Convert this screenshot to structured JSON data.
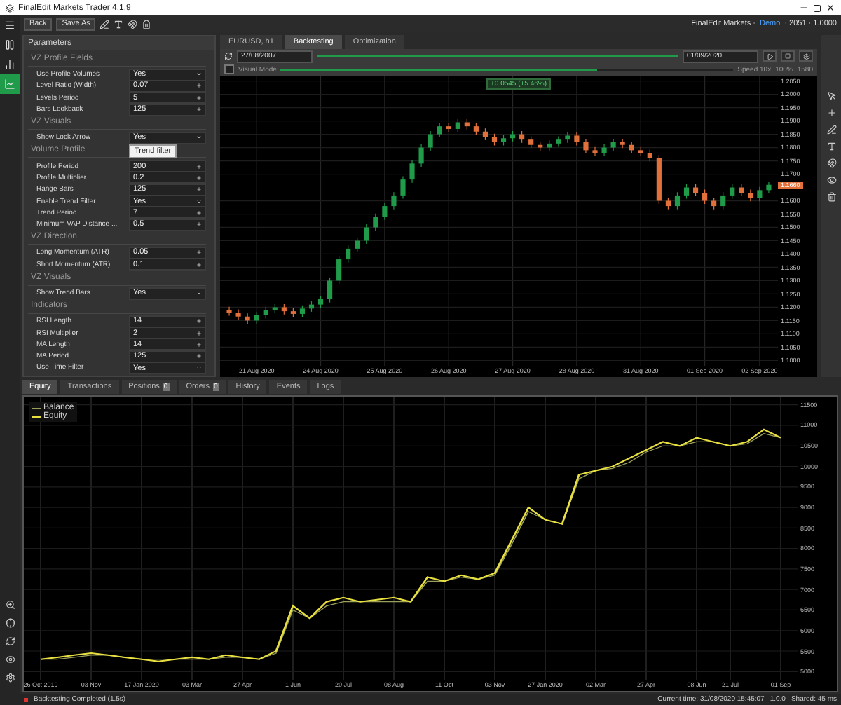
{
  "window": {
    "title": "FinalEdit Markets Trader 4.1.9"
  },
  "rail": {
    "items": [
      {
        "kind": "menu",
        "selected": false
      },
      {
        "kind": "pause",
        "selected": false
      },
      {
        "kind": "trade",
        "selected": false
      },
      {
        "kind": "chart",
        "selected": true
      }
    ]
  },
  "toolbar": {
    "buttons": [
      "Back",
      "Save As"
    ],
    "account": "FinalEdit Markets ·",
    "account_mode": "Demo",
    "account_info": "· 2051 · 1.0000"
  },
  "parameters": {
    "title": "Parameters",
    "sections": [
      {
        "title": "VZ Profile Fields",
        "rows": [
          {
            "label": "Use Profile Volumes",
            "value": "Yes",
            "kind": "select"
          },
          {
            "label": "Level Ratio (Width)",
            "value": "0.07",
            "kind": "number"
          },
          {
            "label": "Levels Period",
            "value": "5",
            "kind": "number"
          },
          {
            "label": "Bars Lookback",
            "value": "125",
            "kind": "number"
          }
        ]
      },
      {
        "title": "VZ Visuals",
        "rows": [
          {
            "label": "Show Lock Arrow",
            "value": "Yes",
            "kind": "select"
          }
        ]
      },
      {
        "title": "Volume Profile",
        "rows": [
          {
            "label": "Profile Period",
            "value": "200",
            "kind": "number"
          },
          {
            "label": "Profile Multiplier",
            "value": "0.2",
            "kind": "number"
          },
          {
            "label": "Range Bars",
            "value": "125",
            "kind": "number"
          },
          {
            "label": "Enable Trend Filter",
            "value": "Yes",
            "kind": "select"
          },
          {
            "label": "Trend Period",
            "value": "7",
            "kind": "number"
          },
          {
            "label": "Minimum VAP Distance ...",
            "value": "0.5",
            "kind": "number"
          }
        ]
      },
      {
        "title": "VZ Direction",
        "rows": [
          {
            "label": "Long Momentum (ATR)",
            "value": "0.05",
            "kind": "number"
          },
          {
            "label": "Short Momentum (ATR)",
            "value": "0.1",
            "kind": "number"
          }
        ]
      },
      {
        "title": "VZ Visuals",
        "rows": [
          {
            "label": "Show Trend Bars",
            "value": "Yes",
            "kind": "select"
          }
        ]
      },
      {
        "title": "Indicators",
        "rows": [
          {
            "label": "RSI Length",
            "value": "14",
            "kind": "number"
          },
          {
            "label": "RSI Multiplier",
            "value": "2",
            "kind": "number"
          },
          {
            "label": "MA Length",
            "value": "14",
            "kind": "number"
          },
          {
            "label": "MA Period",
            "value": "125",
            "kind": "number"
          },
          {
            "label": "Use Time Filter",
            "value": "Yes",
            "kind": "select"
          }
        ]
      }
    ],
    "tooltip": "Trend filter"
  },
  "chart_tabs": [
    {
      "label": "EURUSD, h1",
      "selected": false
    },
    {
      "label": "Backtesting",
      "selected": true
    },
    {
      "label": "Optimization",
      "selected": false
    }
  ],
  "backtest": {
    "start_date": "27/08/2007",
    "end_date": "01/09/2020",
    "progress_bar": {
      "level": 1.0
    },
    "visual_mode": {
      "label": "Visual Mode",
      "checked": false
    },
    "speed_label": "Speed 10x",
    "speed_slider": {
      "level": 0.7
    },
    "speed_value": "100%",
    "readout": "1580"
  },
  "chart": {
    "crosshair_label": "+0.0545 (+5.46%)",
    "chart_data": {
      "type": "candlestick",
      "categories": [
        null,
        null,
        null,
        "21 Aug 2020",
        null,
        null,
        null,
        null,
        null,
        null,
        "24 Aug 2020",
        null,
        null,
        null,
        null,
        null,
        null,
        "25 Aug 2020",
        null,
        null,
        null,
        null,
        null,
        null,
        "26 Aug 2020",
        null,
        null,
        null,
        null,
        null,
        null,
        "27 Aug 2020",
        null,
        null,
        null,
        null,
        null,
        null,
        "28 Aug 2020",
        null,
        null,
        null,
        null,
        null,
        null,
        "31 Aug 2020",
        null,
        null,
        null,
        null,
        null,
        null,
        "01 Sep 2020",
        null,
        null,
        null,
        null,
        null,
        "02 Sep 2020",
        null
      ],
      "grid": true,
      "ylim": [
        1.098,
        1.207
      ],
      "ohlc": [
        [
          1.119,
          1.1202,
          1.1168,
          1.118
        ],
        [
          1.118,
          1.1192,
          1.1153,
          1.1165
        ],
        [
          1.1165,
          1.1177,
          1.1138,
          1.115
        ],
        [
          1.115,
          1.1182,
          1.1138,
          1.117
        ],
        [
          1.117,
          1.1202,
          1.1158,
          1.119
        ],
        [
          1.119,
          1.1212,
          1.1178,
          1.12
        ],
        [
          1.12,
          1.1212,
          1.1173,
          1.1185
        ],
        [
          1.1185,
          1.1197,
          1.1163,
          1.1175
        ],
        [
          1.1175,
          1.1207,
          1.1163,
          1.1195
        ],
        [
          1.1195,
          1.1222,
          1.1183,
          1.121
        ],
        [
          1.121,
          1.1242,
          1.1198,
          1.123
        ],
        [
          1.123,
          1.1312,
          1.1218,
          1.13
        ],
        [
          1.13,
          1.1392,
          1.1288,
          1.138
        ],
        [
          1.138,
          1.1432,
          1.1368,
          1.142
        ],
        [
          1.142,
          1.1462,
          1.1408,
          1.145
        ],
        [
          1.145,
          1.1512,
          1.1438,
          1.15
        ],
        [
          1.15,
          1.1552,
          1.1488,
          1.154
        ],
        [
          1.154,
          1.1592,
          1.1528,
          1.158
        ],
        [
          1.158,
          1.1632,
          1.1568,
          1.162
        ],
        [
          1.162,
          1.1692,
          1.1608,
          1.168
        ],
        [
          1.168,
          1.1752,
          1.1668,
          1.174
        ],
        [
          1.174,
          1.1812,
          1.1728,
          1.18
        ],
        [
          1.18,
          1.1862,
          1.1788,
          1.185
        ],
        [
          1.185,
          1.1892,
          1.1838,
          1.188
        ],
        [
          1.188,
          1.1892,
          1.1858,
          1.187
        ],
        [
          1.187,
          1.1907,
          1.1858,
          1.1895
        ],
        [
          1.1895,
          1.1907,
          1.1868,
          1.188
        ],
        [
          1.188,
          1.1892,
          1.1848,
          1.186
        ],
        [
          1.186,
          1.1872,
          1.1828,
          1.184
        ],
        [
          1.184,
          1.1852,
          1.1808,
          1.182
        ],
        [
          1.182,
          1.1847,
          1.1808,
          1.1835
        ],
        [
          1.1835,
          1.1862,
          1.1823,
          1.185
        ],
        [
          1.185,
          1.1862,
          1.1818,
          1.183
        ],
        [
          1.183,
          1.1842,
          1.1798,
          1.181
        ],
        [
          1.181,
          1.1822,
          1.1788,
          1.18
        ],
        [
          1.18,
          1.1827,
          1.1788,
          1.1815
        ],
        [
          1.1815,
          1.1842,
          1.1803,
          1.183
        ],
        [
          1.183,
          1.1857,
          1.1818,
          1.1845
        ],
        [
          1.1845,
          1.1857,
          1.1808,
          1.182
        ],
        [
          1.182,
          1.1832,
          1.1778,
          1.179
        ],
        [
          1.179,
          1.1802,
          1.1768,
          1.178
        ],
        [
          1.178,
          1.1812,
          1.1768,
          1.18
        ],
        [
          1.18,
          1.1832,
          1.1788,
          1.182
        ],
        [
          1.182,
          1.1832,
          1.1798,
          1.181
        ],
        [
          1.181,
          1.1822,
          1.1778,
          1.179
        ],
        [
          1.179,
          1.1802,
          1.1768,
          1.178
        ],
        [
          1.178,
          1.1792,
          1.1748,
          1.176
        ],
        [
          1.176,
          1.1772,
          1.1588,
          1.16
        ],
        [
          1.16,
          1.1612,
          1.1568,
          1.158
        ],
        [
          1.158,
          1.1632,
          1.1568,
          1.162
        ],
        [
          1.162,
          1.1662,
          1.1608,
          1.165
        ],
        [
          1.165,
          1.1662,
          1.1618,
          1.163
        ],
        [
          1.163,
          1.1642,
          1.1588,
          1.16
        ],
        [
          1.16,
          1.1612,
          1.1568,
          1.158
        ],
        [
          1.158,
          1.1632,
          1.1568,
          1.162
        ],
        [
          1.162,
          1.1662,
          1.1608,
          1.165
        ],
        [
          1.165,
          1.1662,
          1.1618,
          1.163
        ],
        [
          1.163,
          1.1642,
          1.1598,
          1.161
        ],
        [
          1.161,
          1.1652,
          1.1598,
          1.164
        ],
        [
          1.164,
          1.1672,
          1.1628,
          1.166
        ]
      ],
      "yticks": [
        {
          "value": 1.205,
          "label": "1.2050"
        },
        {
          "value": 1.2,
          "label": "1.2000"
        },
        {
          "value": 1.195,
          "label": "1.1950"
        },
        {
          "value": 1.19,
          "label": "1.1900"
        },
        {
          "value": 1.185,
          "label": "1.1850"
        },
        {
          "value": 1.18,
          "label": "1.1800"
        },
        {
          "value": 1.175,
          "label": "1.1750"
        },
        {
          "value": 1.17,
          "label": "1.1700"
        },
        {
          "value": 1.16,
          "label": "1.1600"
        },
        {
          "value": 1.155,
          "label": "1.1550"
        },
        {
          "value": 1.15,
          "label": "1.1500"
        },
        {
          "value": 1.145,
          "label": "1.1450"
        },
        {
          "value": 1.14,
          "label": "1.1400"
        },
        {
          "value": 1.135,
          "label": "1.1350"
        },
        {
          "value": 1.13,
          "label": "1.1300"
        },
        {
          "value": 1.125,
          "label": "1.1250"
        },
        {
          "value": 1.12,
          "label": "1.1200"
        },
        {
          "value": 1.115,
          "label": "1.1150"
        },
        {
          "value": 1.11,
          "label": "1.1100"
        },
        {
          "value": 1.105,
          "label": "1.1050"
        },
        {
          "value": 1.1,
          "label": "1.1000"
        }
      ],
      "annotations": [
        "1.1660"
      ]
    }
  },
  "bottom_tabs": [
    {
      "label": "Equity",
      "selected": true
    },
    {
      "label": "Transactions",
      "selected": false
    },
    {
      "label": "Positions",
      "badge": "0",
      "selected": false
    },
    {
      "label": "Orders",
      "badge": "0",
      "selected": false
    },
    {
      "label": "History",
      "selected": false
    },
    {
      "label": "Events",
      "selected": false
    },
    {
      "label": "Logs",
      "selected": false
    }
  ],
  "equity": {
    "chart_data": {
      "type": "line",
      "categories": [
        "26 Oct 2019",
        null,
        null,
        "03 Nov",
        null,
        null,
        "17 Jan 2020",
        null,
        null,
        "03 Mar",
        null,
        null,
        "27 Apr",
        null,
        null,
        "1 Jun",
        null,
        null,
        "20 Jul",
        null,
        null,
        "08 Aug",
        null,
        null,
        "11 Oct",
        null,
        null,
        "03 Nov",
        null,
        null,
        "27 Jan 2020",
        null,
        null,
        "02 Mar",
        null,
        null,
        "27 Apr",
        null,
        null,
        "08 Jun",
        null,
        "21 Jul",
        null,
        null,
        "01 Sep"
      ],
      "grid": true,
      "legend": true,
      "ylim": [
        4800,
        11700
      ],
      "series": [
        {
          "name": "Balance",
          "color": "#9aa05a",
          "values": [
            5300,
            5300,
            5350,
            5400,
            5400,
            5350,
            5300,
            5300,
            5300,
            5300,
            5300,
            5350,
            5350,
            5300,
            5450,
            6500,
            6300,
            6600,
            6700,
            6700,
            6700,
            6700,
            6700,
            7200,
            7200,
            7300,
            7250,
            7350,
            8100,
            8900,
            8700,
            8600,
            9700,
            9900,
            9950,
            10100,
            10350,
            10500,
            10500,
            10600,
            10600,
            10500,
            10550,
            10800,
            10700
          ]
        },
        {
          "name": "Equity",
          "color": "#e8e040",
          "values": [
            5300,
            5350,
            5400,
            5450,
            5400,
            5350,
            5300,
            5250,
            5300,
            5350,
            5300,
            5400,
            5350,
            5300,
            5500,
            6600,
            6300,
            6700,
            6800,
            6700,
            6750,
            6800,
            6700,
            7300,
            7200,
            7350,
            7250,
            7400,
            8200,
            9000,
            8700,
            8600,
            9800,
            9900,
            10000,
            10200,
            10400,
            10600,
            10500,
            10700,
            10600,
            10500,
            10600,
            10900,
            10700
          ]
        }
      ],
      "yticks": [
        11500,
        11000,
        10500,
        10000,
        9500,
        9000,
        8500,
        8000,
        7500,
        7000,
        6500,
        6000,
        5500,
        5000
      ],
      "title": null
    }
  },
  "status": {
    "message": "Backtesting Completed (1.5s)",
    "current_time": "Current time: 31/08/2020 15:45:07",
    "version": "1.0.0",
    "latency": "Shared: 45 ms"
  }
}
